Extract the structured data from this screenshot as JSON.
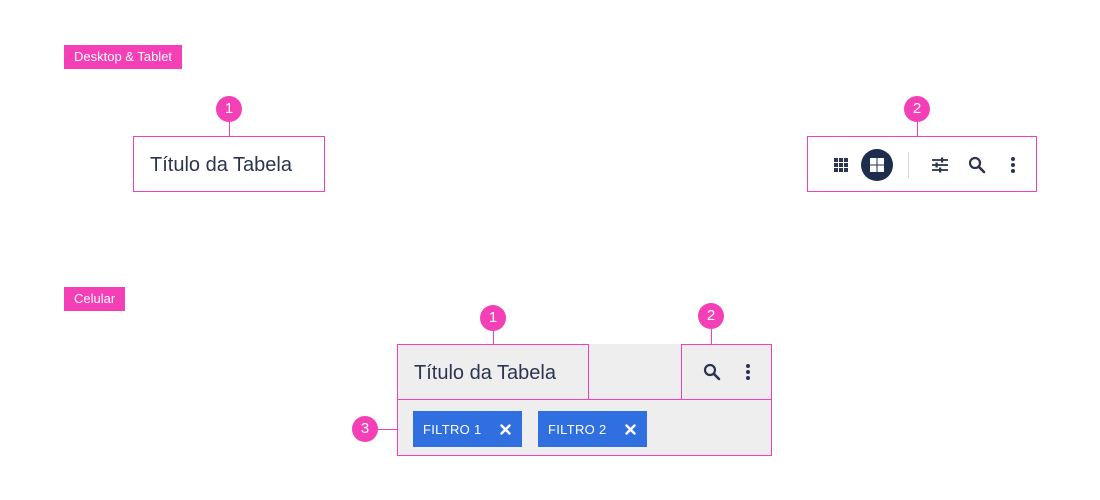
{
  "desktop_section": {
    "tag": "Desktop & Tablet",
    "markers": {
      "title": "1",
      "toolbar": "2"
    },
    "table_title": "Título da Tabela",
    "toolbar_icons": [
      "grid-small-icon",
      "grid-large-icon",
      "filter-sliders-icon",
      "search-icon",
      "more-vertical-icon"
    ]
  },
  "mobile_section": {
    "tag": "Celular",
    "markers": {
      "title": "1",
      "actions": "2",
      "filters": "3"
    },
    "table_title": "Título da Tabela",
    "action_icons": [
      "search-icon",
      "more-vertical-icon"
    ],
    "filters": [
      {
        "label": "FILTRO 1"
      },
      {
        "label": "FILTRO 2"
      }
    ]
  },
  "colors": {
    "accent_pink": "#f43fb7",
    "chip_blue": "#2f6fe0",
    "text_dark": "#2b3550",
    "header_bg": "#eeeeee",
    "active_toggle": "#1f2d4d"
  }
}
